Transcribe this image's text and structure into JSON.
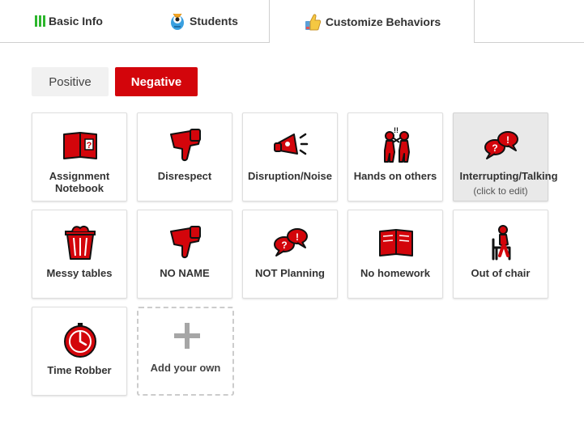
{
  "tabs": {
    "basic_info": "Basic Info",
    "students": "Students",
    "customize": "Customize Behaviors"
  },
  "toggle": {
    "positive": "Positive",
    "negative": "Negative"
  },
  "behaviors": [
    {
      "label": "Assignment Notebook",
      "icon": "book-question-icon"
    },
    {
      "label": "Disrespect",
      "icon": "thumbs-down-icon"
    },
    {
      "label": "Disruption/Noise",
      "icon": "megaphone-icon"
    },
    {
      "label": "Hands on others",
      "icon": "fighting-people-icon"
    },
    {
      "label": "Interrupting/Talking",
      "icon": "speech-bubbles-icon",
      "hint": "(click to edit)"
    },
    {
      "label": "Messy tables",
      "icon": "trash-can-icon"
    },
    {
      "label": "NO NAME",
      "icon": "thumbs-down-icon"
    },
    {
      "label": "NOT Planning",
      "icon": "speech-bubbles-icon"
    },
    {
      "label": "No homework",
      "icon": "book-open-icon"
    },
    {
      "label": "Out of chair",
      "icon": "chair-person-icon"
    },
    {
      "label": "Time Robber",
      "icon": "clock-icon"
    }
  ],
  "add": {
    "label": "Add your own"
  },
  "colors": {
    "accent": "#d3050b",
    "tab_green": "#2db62d"
  }
}
